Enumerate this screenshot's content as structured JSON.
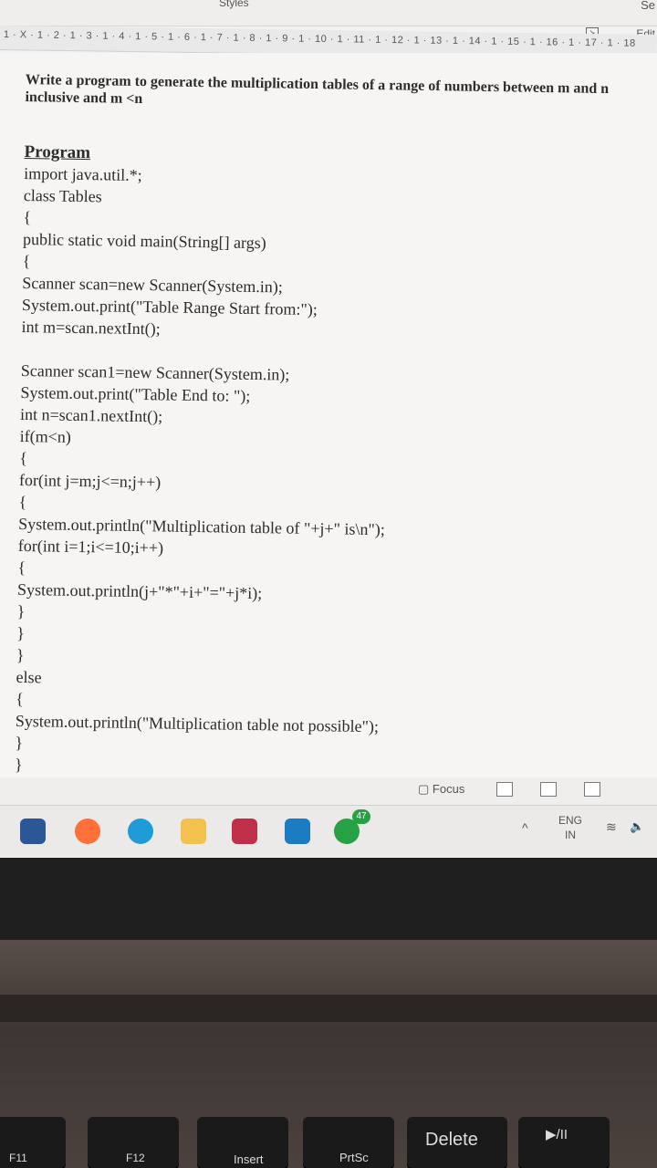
{
  "ribbon": {
    "styles_label": "Styles",
    "select_label": "Se",
    "edit_label": "Edit"
  },
  "ruler": {
    "marks": "1 · X · 1 · 2 · 1 · 3 · 1 · 4 · 1 · 5 · 1 · 6 · 1 · 7 · 1 · 8 · 1 · 9 · 1 · 10 · 1 · 11 · 1 · 12 · 1 · 13 · 1 · 14 · 1 · 15 · 1 · 16 · 1 · 17 · 1 · 18"
  },
  "document": {
    "heading": "Write a program to generate the multiplication tables of a range of numbers between m and n inclusive and m <n",
    "program_title": "Program",
    "lines": [
      "import java.util.*;",
      "class Tables",
      "{",
      "public static void main(String[] args)",
      "{",
      "Scanner scan=new Scanner(System.in);",
      "System.out.print(\"Table Range Start from:\");",
      "int m=scan.nextInt();",
      "",
      "Scanner scan1=new Scanner(System.in);",
      "System.out.print(\"Table End to: \");",
      "int n=scan1.nextInt();",
      "if(m<n)",
      "{",
      "for(int j=m;j<=n;j++)",
      "{",
      "System.out.println(\"Multiplication table of \"+j+\" is\\n\");",
      "for(int i=1;i<=10;i++)",
      "{",
      "System.out.println(j+\"*\"+i+\"=\"+j*i);",
      "}",
      "}",
      "}",
      "else",
      "{",
      "System.out.println(\"Multiplication table not possible\");",
      "}",
      "}",
      "}"
    ]
  },
  "statusbar": {
    "focus_label": "Focus"
  },
  "taskbar": {
    "whatsapp_badge": "47",
    "language_top": "ENG",
    "language_bottom": "IN"
  },
  "keyboard": {
    "keys": [
      "F11",
      "F12",
      "Insert",
      "PrtSc",
      "Delete",
      "▶/II"
    ]
  },
  "colors": {
    "text": "#2d2d2d",
    "page": "#f6f5f3",
    "taskbar": "#eceae8"
  }
}
